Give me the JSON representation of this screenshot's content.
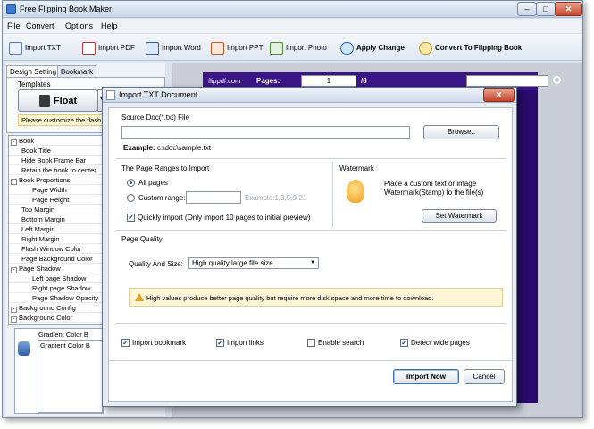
{
  "app": {
    "title": "Free Flipping Book Maker",
    "window_buttons": {
      "minimize": "–",
      "maximize": "□",
      "close": "✕"
    }
  },
  "menu": [
    "File",
    "Convert",
    "Options",
    "Help"
  ],
  "toolbar": {
    "import_txt": "Import TXT",
    "import_pdf": "Import PDF",
    "import_word": "Import Word",
    "import_ppt": "Import PPT",
    "import_photo": "Import Photo",
    "apply_change": "Apply Change",
    "convert": "Convert To Flipping Book"
  },
  "left_panel": {
    "tabs": [
      "Design Setting",
      "Bookmark"
    ],
    "templates_label": "Templates",
    "template_selected": "Float",
    "customize_text": "Please customize the flash",
    "tree": [
      {
        "label": "Book",
        "level": 0,
        "expander": "-"
      },
      {
        "label": "Book Title",
        "level": 1
      },
      {
        "label": "Hide Book Frame Bar",
        "level": 1
      },
      {
        "label": "Retain the book to center",
        "level": 1
      },
      {
        "label": "Book Proportions",
        "level": 0,
        "expander": "-"
      },
      {
        "label": "Page Width",
        "level": 2
      },
      {
        "label": "Page Height",
        "level": 2
      },
      {
        "label": "Top Margin",
        "level": 1
      },
      {
        "label": "Bottom Margin",
        "level": 1
      },
      {
        "label": "Left Margin",
        "level": 1
      },
      {
        "label": "Right Margin",
        "level": 1
      },
      {
        "label": "Flash Window Color",
        "level": 1
      },
      {
        "label": "Page Background Color",
        "level": 1
      },
      {
        "label": "Page Shadow",
        "level": 0,
        "expander": "-"
      },
      {
        "label": "Left page Shadow",
        "level": 2
      },
      {
        "label": "Right page Shadow",
        "level": 2
      },
      {
        "label": "Page Shadow Opacity",
        "level": 2
      },
      {
        "label": "Background Config",
        "level": 0,
        "expander": "-"
      },
      {
        "label": "Background Color",
        "level": 0,
        "expander": "-"
      }
    ],
    "gradient_a": "Gradient Color B",
    "gradient_b": "Gradient Color B"
  },
  "preview": {
    "logo": "flippdf.com",
    "pages_label": "Pages:",
    "current_page": "1",
    "total_pages": "/8"
  },
  "dialog": {
    "title": "Import TXT Document",
    "close": "✕",
    "source_label": "Source Doc(*.txt) File",
    "source_value": "",
    "browse": "Browse..",
    "example_label": "Example:",
    "example_value": "c:\\doc\\sample.txt",
    "page_ranges_title": "The Page Ranges to Import",
    "all_pages": "All pages",
    "custom_range": "Custom range:",
    "custom_range_value": "",
    "custom_range_hint": "Example:1,3,5,9-21",
    "quickly_import": "Quickly import (Only import 10 pages to  initial  preview)",
    "watermark_title": "Watermark",
    "watermark_desc_1": "Place a custom text or image",
    "watermark_desc_2": "Watermark(Stamp) to the file(s)",
    "set_watermark": "Set Watermark",
    "page_quality_title": "Page Quality",
    "quality_label": "Quality And Size:",
    "quality_value": "High quality large file size",
    "warning": "High values produce better page quality but require more disk space and more time to download.",
    "options": {
      "import_bookmark": "Import bookmark",
      "import_links": "Import links",
      "enable_search": "Enable search",
      "detect_wide_pages": "Detect wide pages"
    },
    "import_now": "Import Now",
    "cancel": "Cancel"
  }
}
